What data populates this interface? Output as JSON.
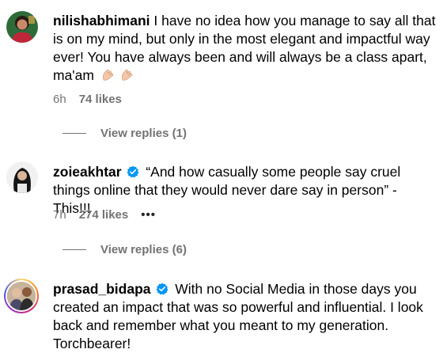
{
  "comments": [
    {
      "username": "nilishabhimani",
      "verified": false,
      "text": "I have no idea how you manage to say all that is on my mind, but only in the most elegant and impactful way ever! You have always been and will always be a class apart, ma'am",
      "emoji": "👏🏻👏🏻",
      "time": "6h",
      "likes": "74 likes",
      "replies_label": "View replies (1)"
    },
    {
      "username": "zoieakhtar",
      "verified": true,
      "text": "“And how casually some people say cruel things online that they would never dare say in person” - This!!!",
      "time": "7h",
      "likes": "274 likes",
      "more_label": "•••",
      "replies_label": "View replies (6)"
    },
    {
      "username": "prasad_bidapa",
      "verified": true,
      "text": "With no Social Media in those days you created an impact that was so powerful and influential. I look back and remember what you meant to my generation. Torchbearer!"
    }
  ],
  "colors": {
    "text": "#000000",
    "secondary": "#737373",
    "verified_blue": "#0095F6"
  },
  "icons": {
    "verified": "verified-badge-icon",
    "clap": "clapping-hands-icon"
  }
}
